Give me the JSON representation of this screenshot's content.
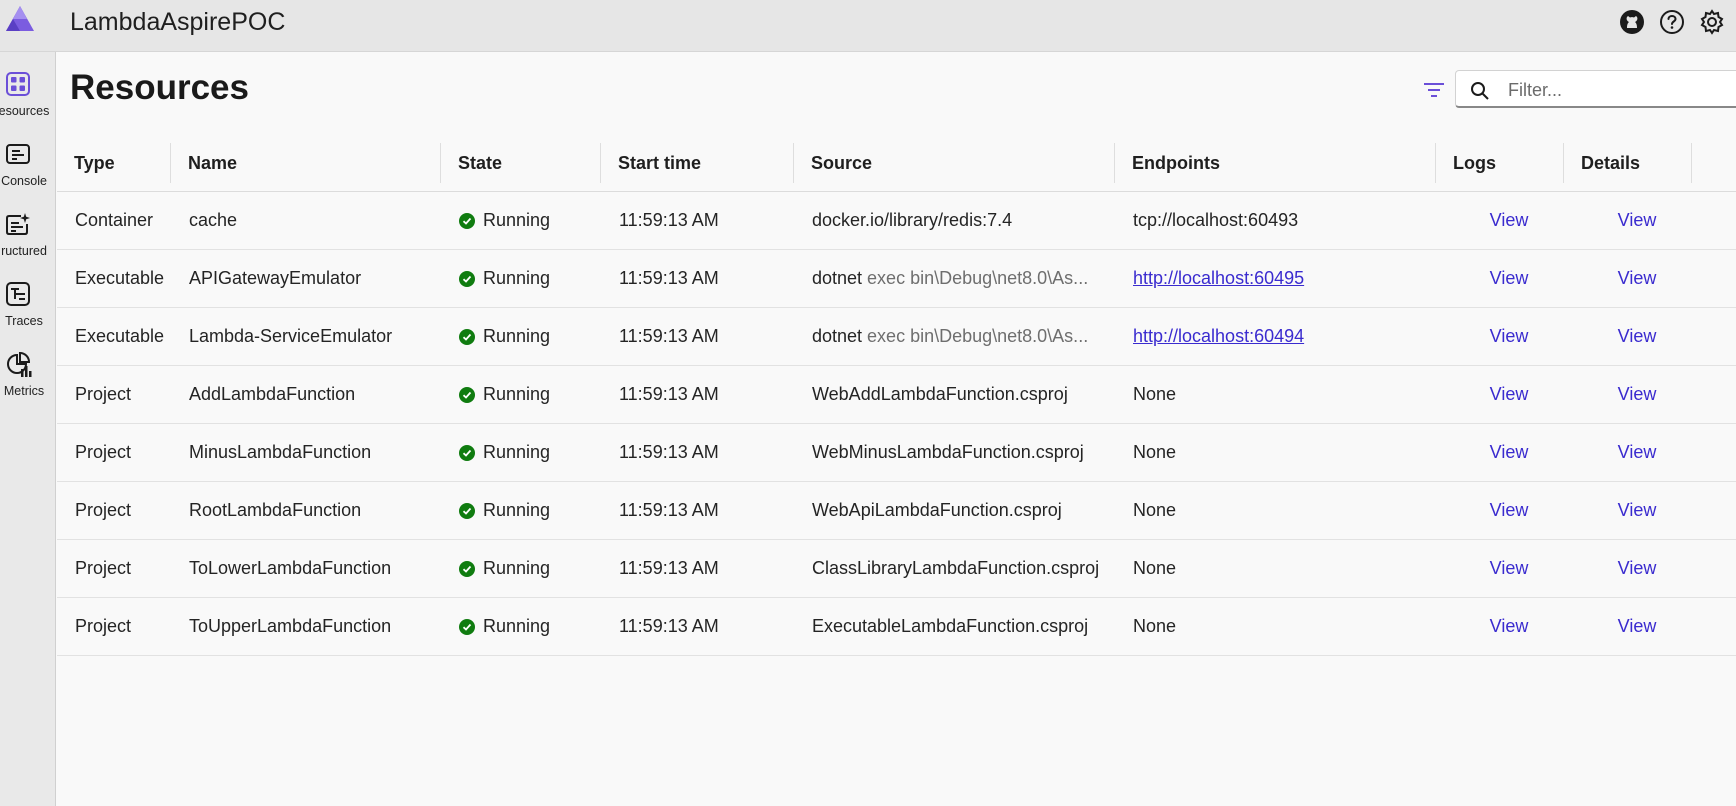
{
  "app": {
    "title": "LambdaAspirePOC"
  },
  "header_icons": [
    "github-icon",
    "help-icon",
    "settings-icon"
  ],
  "sidebar": {
    "items": [
      {
        "label": "esources",
        "icon": "resources-icon",
        "active": true
      },
      {
        "label": "Console",
        "icon": "console-icon"
      },
      {
        "label": "ructured",
        "icon": "structured-icon"
      },
      {
        "label": "Traces",
        "icon": "traces-icon"
      },
      {
        "label": "Metrics",
        "icon": "metrics-icon"
      }
    ]
  },
  "page": {
    "title": "Resources"
  },
  "search": {
    "placeholder": "Filter...",
    "value": ""
  },
  "colors": {
    "accent": "#6b4fd8",
    "link": "#3a2bcf",
    "running": "#107c10"
  },
  "table": {
    "columns": [
      "Type",
      "Name",
      "State",
      "Start time",
      "Source",
      "Endpoints",
      "Logs",
      "Details"
    ],
    "rows": [
      {
        "type": "Container",
        "name": "cache",
        "state": "Running",
        "start": "11:59:13 AM",
        "source_cmd": "docker.io/library/redis:7.4",
        "source_args": "",
        "endpoint": "tcp://localhost:60493",
        "endpoint_link": false,
        "logs": "View",
        "details": "View"
      },
      {
        "type": "Executable",
        "name": "APIGatewayEmulator",
        "state": "Running",
        "start": "11:59:13 AM",
        "source_cmd": "dotnet",
        "source_args": " exec bin\\Debug\\net8.0\\As...",
        "endpoint": "http://localhost:60495",
        "endpoint_link": true,
        "logs": "View",
        "details": "View"
      },
      {
        "type": "Executable",
        "name": "Lambda-ServiceEmulator",
        "state": "Running",
        "start": "11:59:13 AM",
        "source_cmd": "dotnet",
        "source_args": " exec bin\\Debug\\net8.0\\As...",
        "endpoint": "http://localhost:60494",
        "endpoint_link": true,
        "logs": "View",
        "details": "View"
      },
      {
        "type": "Project",
        "name": "AddLambdaFunction",
        "state": "Running",
        "start": "11:59:13 AM",
        "source_cmd": "WebAddLambdaFunction.csproj",
        "source_args": "",
        "endpoint": "None",
        "endpoint_link": false,
        "logs": "View",
        "details": "View"
      },
      {
        "type": "Project",
        "name": "MinusLambdaFunction",
        "state": "Running",
        "start": "11:59:13 AM",
        "source_cmd": "WebMinusLambdaFunction.csproj",
        "source_args": "",
        "endpoint": "None",
        "endpoint_link": false,
        "logs": "View",
        "details": "View"
      },
      {
        "type": "Project",
        "name": "RootLambdaFunction",
        "state": "Running",
        "start": "11:59:13 AM",
        "source_cmd": "WebApiLambdaFunction.csproj",
        "source_args": "",
        "endpoint": "None",
        "endpoint_link": false,
        "logs": "View",
        "details": "View"
      },
      {
        "type": "Project",
        "name": "ToLowerLambdaFunction",
        "state": "Running",
        "start": "11:59:13 AM",
        "source_cmd": "ClassLibraryLambdaFunction.csproj",
        "source_args": "",
        "endpoint": "None",
        "endpoint_link": false,
        "logs": "View",
        "details": "View"
      },
      {
        "type": "Project",
        "name": "ToUpperLambdaFunction",
        "state": "Running",
        "start": "11:59:13 AM",
        "source_cmd": "ExecutableLambdaFunction.csproj",
        "source_args": "",
        "endpoint": "None",
        "endpoint_link": false,
        "logs": "View",
        "details": "View"
      }
    ]
  }
}
